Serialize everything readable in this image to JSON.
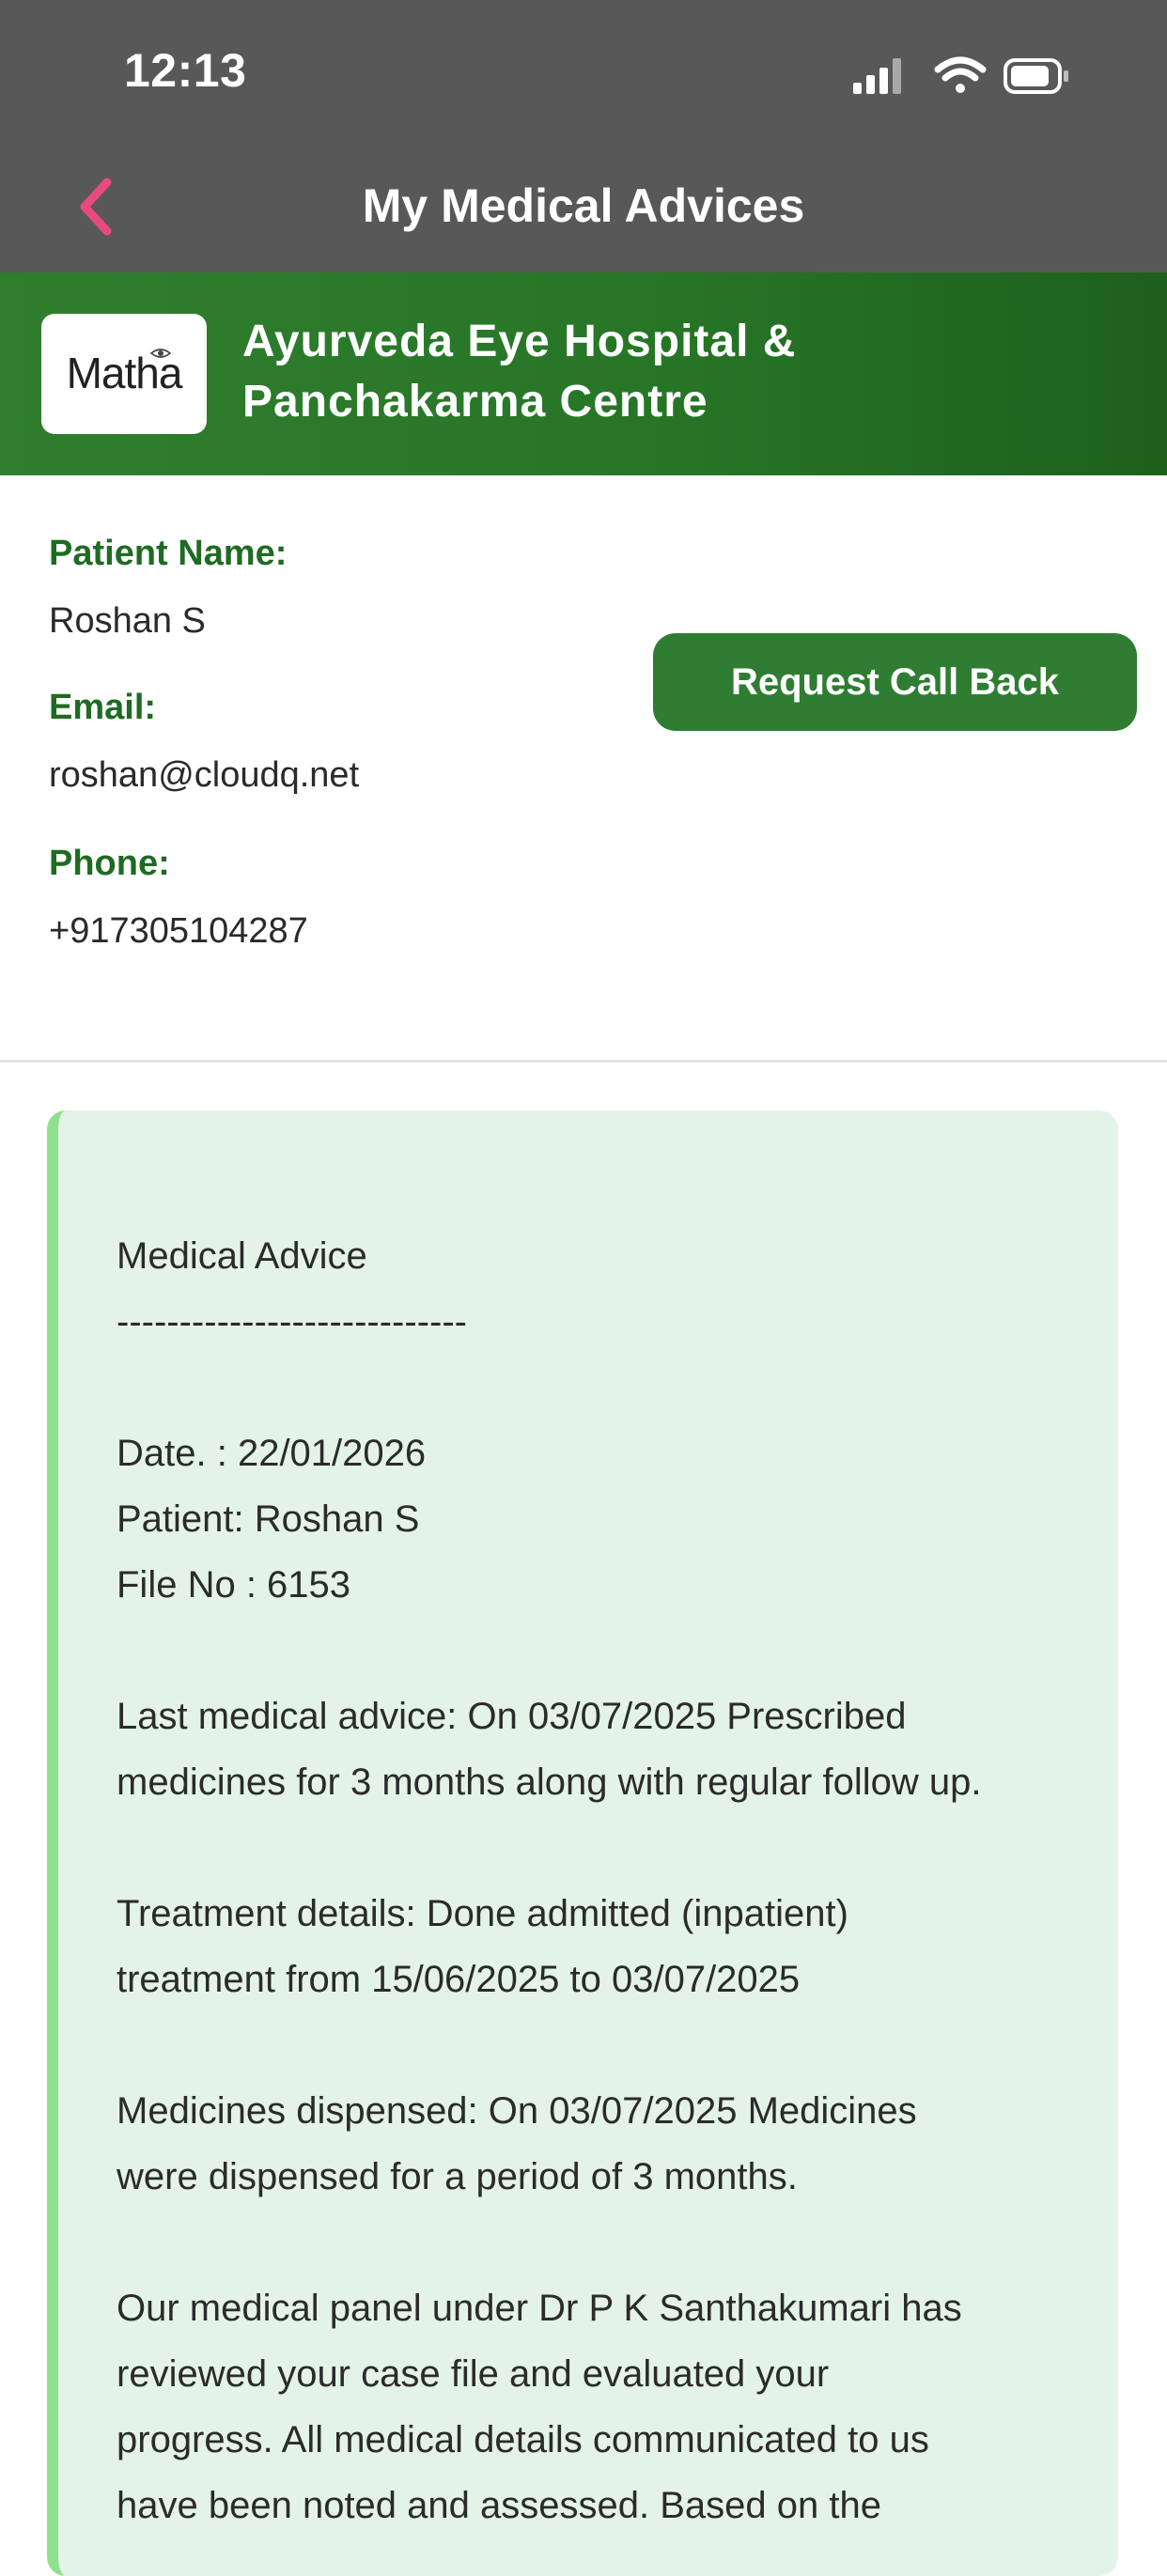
{
  "status_bar": {
    "time": "12:13"
  },
  "nav": {
    "title": "My Medical Advices",
    "back_icon": "chevron-left-icon",
    "back_color": "#e84a7f"
  },
  "hospital": {
    "logo_text": "Matha",
    "name_line1": "Ayurveda Eye Hospital &",
    "name_line2": "Panchakarma Centre",
    "brand_color": "#2e7d32"
  },
  "patient": {
    "name_label": "Patient Name:",
    "name": "Roshan S",
    "email_label": "Email:",
    "email": "roshan@cloudq.net",
    "phone_label": "Phone:",
    "phone": "+917305104287"
  },
  "actions": {
    "request_callback": "Request Call Back"
  },
  "advice": {
    "heading": "Medical Advice",
    "separator": "----------------------------",
    "date": "Date. : 22/01/2026",
    "patient": "Patient: Roshan S",
    "file_no": "File No : 6153",
    "last_advice_1": "Last medical advice: On 03/07/2025 Prescribed",
    "last_advice_2": "medicines for 3 months along with regular follow up.",
    "treatment_1": "Treatment details: Done admitted (inpatient)",
    "treatment_2": "treatment from 15/06/2025 to 03/07/2025",
    "medicines_1": "Medicines dispensed: On 03/07/2025 Medicines",
    "medicines_2": "were dispensed for a period of 3 months.",
    "panel_1": "Our medical panel under Dr P K Santhakumari has",
    "panel_2": "reviewed your case file and evaluated your",
    "panel_3": "progress. All medical details communicated to us",
    "panel_4": "have been noted and assessed. Based on the"
  }
}
